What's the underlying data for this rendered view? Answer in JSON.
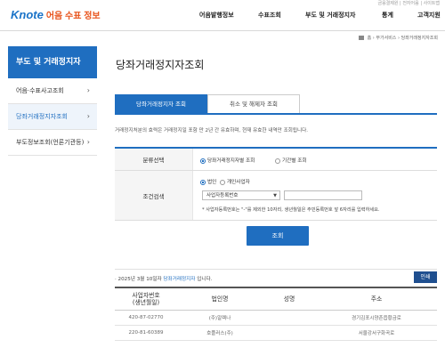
{
  "header": {
    "logo_brand": "Knote",
    "logo_sub": "어음 수표 정보",
    "top_note": "금융결제원 | 전자어음 | 사이트맵",
    "nav": [
      "어음발행정보",
      "수표조회",
      "부도 및 거래정지자",
      "통계",
      "고객지원"
    ]
  },
  "breadcrumb": {
    "items": [
      "홈",
      "부가서비스",
      "당좌거래정지자조회"
    ]
  },
  "sidebar": {
    "title": "부도 및 거래정지자",
    "items": [
      {
        "label": "어음·수표사고조회",
        "active": false
      },
      {
        "label": "당좌거래정지자조회",
        "active": true
      },
      {
        "label": "부도정보조회(언론기관등)",
        "active": false
      }
    ]
  },
  "main": {
    "title": "당좌거래정지자조회",
    "tabs": [
      {
        "label": "당좌거래정지자 조회",
        "active": true
      },
      {
        "label": "취소 및 해제자 조회",
        "active": false
      }
    ],
    "description": "거래정지처분의 효력은 거래정지일 포함 만 2년 간 유효하며, 현재 유효한 내역만 조회됩니다.",
    "form": {
      "category_label": "분류선택",
      "category_options": [
        "당좌거래정지자별 조회",
        "기간별 조회"
      ],
      "condition_label": "조건검색",
      "type_options": [
        "법인",
        "개인사업자"
      ],
      "select_value": "사업자등록번호",
      "input_value": "",
      "hint": "* 사업자등록번호는 \"-\"를 제외한 10자리, 생년월일은 주민등록번호 앞 6자리를 입력하세요."
    },
    "search_button": "조회",
    "result": {
      "prefix": "· 2025년 3월 10일자",
      "highlight": "당좌거래정지자",
      "suffix": "입니다.",
      "print_button": "인쇄",
      "columns": [
        "사업자번호\n(생년월일)",
        "법인명",
        "성명",
        "주소"
      ],
      "rows": [
        [
          "420-87-02770",
          "(주)알렉나",
          "",
          "경기김포시양촌읍황금로"
        ],
        [
          "220-81-60389",
          "호플러스(주)",
          "",
          "서울강서구화곡로"
        ]
      ]
    }
  }
}
